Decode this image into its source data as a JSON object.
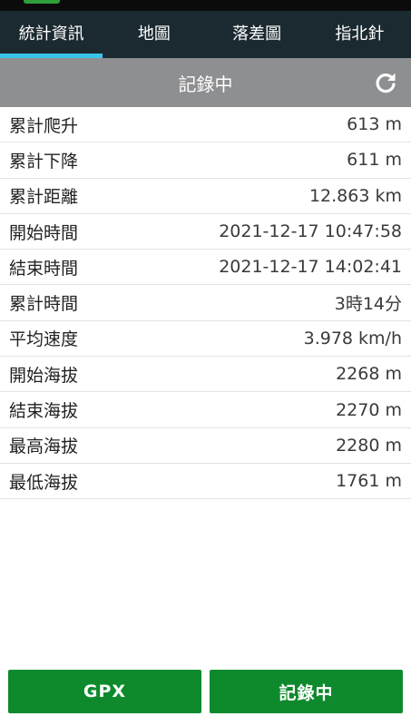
{
  "tabs": [
    {
      "label": "統計資訊",
      "active": true
    },
    {
      "label": "地圖",
      "active": false
    },
    {
      "label": "落差圖",
      "active": false
    },
    {
      "label": "指北針",
      "active": false
    }
  ],
  "header": {
    "title": "記錄中",
    "refresh_icon": "refresh-icon"
  },
  "stats": [
    {
      "label": "累計爬升",
      "value": "613 m"
    },
    {
      "label": "累計下降",
      "value": "611 m"
    },
    {
      "label": "累計距離",
      "value": "12.863 km"
    },
    {
      "label": "開始時間",
      "value": "2021-12-17 10:47:58"
    },
    {
      "label": "結束時間",
      "value": "2021-12-17 14:02:41"
    },
    {
      "label": "累計時間",
      "value": "3時14分"
    },
    {
      "label": "平均速度",
      "value": "3.978 km/h"
    },
    {
      "label": "開始海拔",
      "value": "2268 m"
    },
    {
      "label": "結束海拔",
      "value": "2270 m"
    },
    {
      "label": "最高海拔",
      "value": "2280 m"
    },
    {
      "label": "最低海拔",
      "value": "1761 m"
    }
  ],
  "footer": {
    "gpx_label": "GPX",
    "record_label": "記錄中"
  },
  "colors": {
    "tabbar_bg": "#1b2a31",
    "tab_indicator": "#39c4e8",
    "titlebar_bg": "#8e8f90",
    "button_green": "#0e8a2d"
  }
}
